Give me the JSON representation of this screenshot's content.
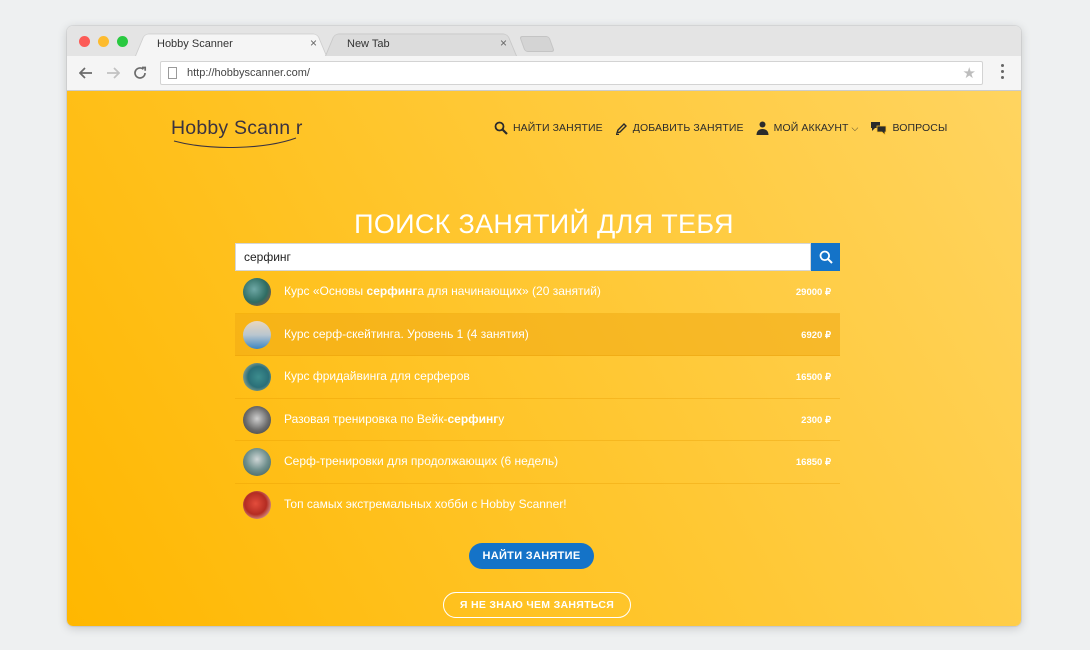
{
  "browser": {
    "tabs": [
      {
        "label": "Hobby Scanner",
        "active": true
      },
      {
        "label": "New Tab",
        "active": false
      }
    ],
    "tab_close_glyph": "×",
    "url": "http://hobbyscanner.com/",
    "traffic_lights": [
      "#fc5b57",
      "#fdbb2e",
      "#29c940"
    ]
  },
  "site": {
    "logo_text": "Hobby Scann r",
    "nav": [
      {
        "label": "НАЙТИ ЗАНЯТИЕ",
        "icon": "search-icon"
      },
      {
        "label": "ДОБАВИТЬ ЗАНЯТИЕ",
        "icon": "pencil-icon"
      },
      {
        "label": "МОЙ АККАУНТ",
        "icon": "user-icon",
        "has_dropdown": true
      },
      {
        "label": "ВОПРОСЫ",
        "icon": "chat-bubbles-icon"
      }
    ],
    "hero_title": "ПОИСК ЗАНЯТИЙ ДЛЯ ТЕБЯ",
    "search": {
      "value": "серфинг"
    },
    "results": [
      {
        "before": "Курс «Основы ",
        "bold": "серфинг",
        "after": "а для начинающих» (20 занятий)",
        "price": "29000 ₽"
      },
      {
        "before": "Курс серф-скейтинга. Уровень 1 (4 занятия)",
        "bold": "",
        "after": "",
        "price": "6920 ₽",
        "highlight": true
      },
      {
        "before": "Курс фридайвинга для серферов",
        "bold": "",
        "after": "",
        "price": "16500 ₽"
      },
      {
        "before": "Разовая тренировка по Вейк-",
        "bold": "серфинг",
        "after": "у",
        "price": "2300 ₽"
      },
      {
        "before": "Серф-тренировки для продолжающих (6 недель)",
        "bold": "",
        "after": "",
        "price": "16850 ₽"
      },
      {
        "before": "Топ самых экстремальных хобби с Hobby Scanner!",
        "bold": "",
        "after": "",
        "price": ""
      }
    ],
    "cta_primary": "НАЙТИ ЗАНЯТИЕ",
    "cta_secondary": "Я НЕ ЗНАЮ ЧЕМ ЗАНЯТЬСЯ"
  },
  "colors": {
    "accent_blue": "#1473c8",
    "background_yellow": "#ffc22a"
  }
}
